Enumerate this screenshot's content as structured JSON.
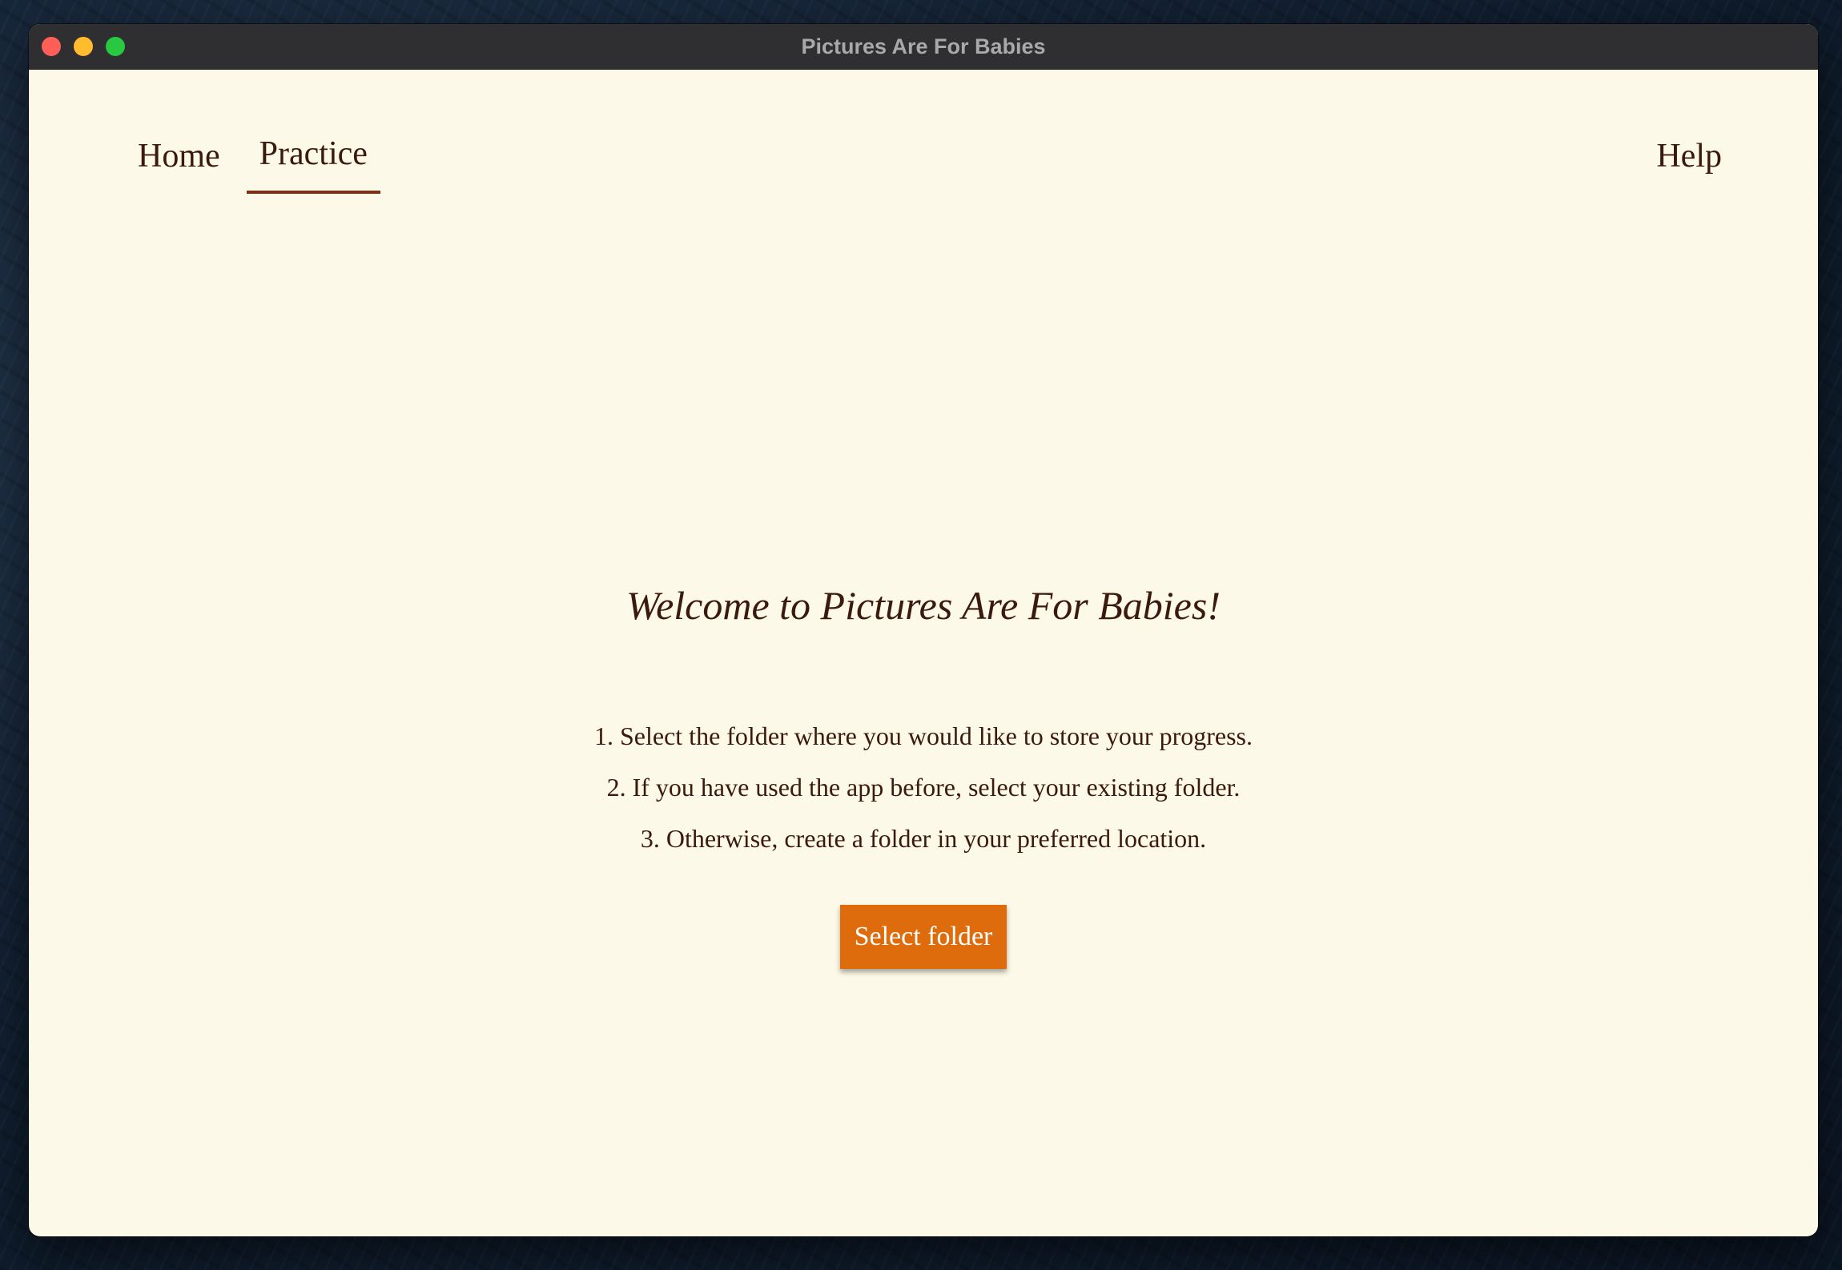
{
  "window": {
    "title": "Pictures Are For Babies"
  },
  "nav": {
    "tabs": [
      {
        "label": "Home",
        "active": false
      },
      {
        "label": "Practice",
        "active": true
      }
    ],
    "help_label": "Help"
  },
  "main": {
    "welcome": "Welcome to Pictures Are For Babies!",
    "steps": [
      "1. Select the folder where you would like to store your progress.",
      "2. If you have used the app before, select your existing folder.",
      "3. Otherwise, create a folder in your preferred location."
    ],
    "select_folder_label": "Select folder"
  },
  "colors": {
    "background": "#fdf9e8",
    "text": "#3b1a0e",
    "accent_underline": "#7a3216",
    "button": "#de6b0c",
    "titlebar": "#2f2f31"
  }
}
